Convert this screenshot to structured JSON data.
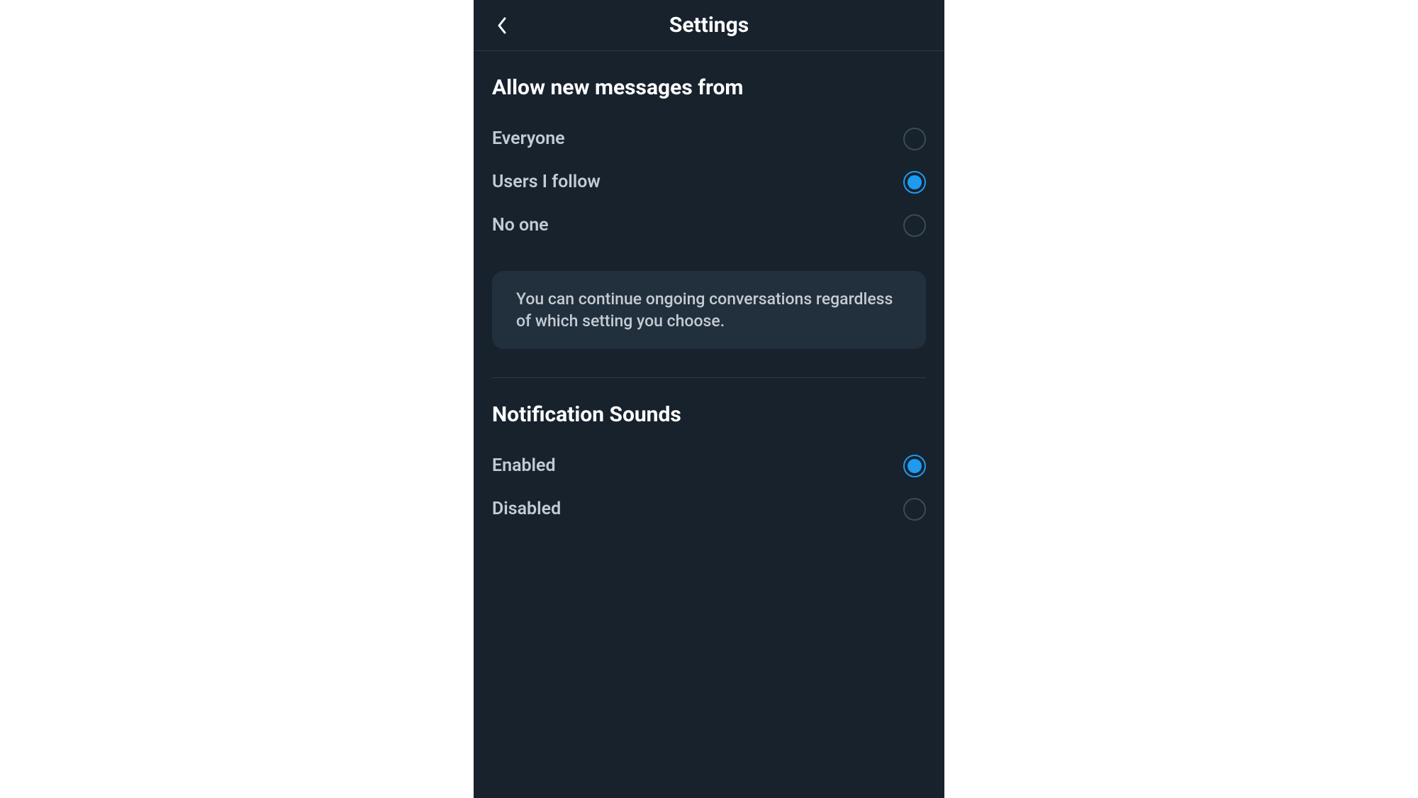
{
  "header": {
    "title": "Settings"
  },
  "sections": {
    "messages": {
      "title": "Allow new messages from",
      "options": {
        "everyone": "Everyone",
        "users_i_follow": "Users I follow",
        "no_one": "No one"
      },
      "selected": "users_i_follow",
      "info": "You can continue ongoing conversations regardless of which setting you choose."
    },
    "sounds": {
      "title": "Notification Sounds",
      "options": {
        "enabled": "Enabled",
        "disabled": "Disabled"
      },
      "selected": "enabled"
    }
  },
  "colors": {
    "accent": "#1d9bf0",
    "bg": "#17222d",
    "panel": "#222f3c",
    "muted": "#c3cbd3"
  }
}
